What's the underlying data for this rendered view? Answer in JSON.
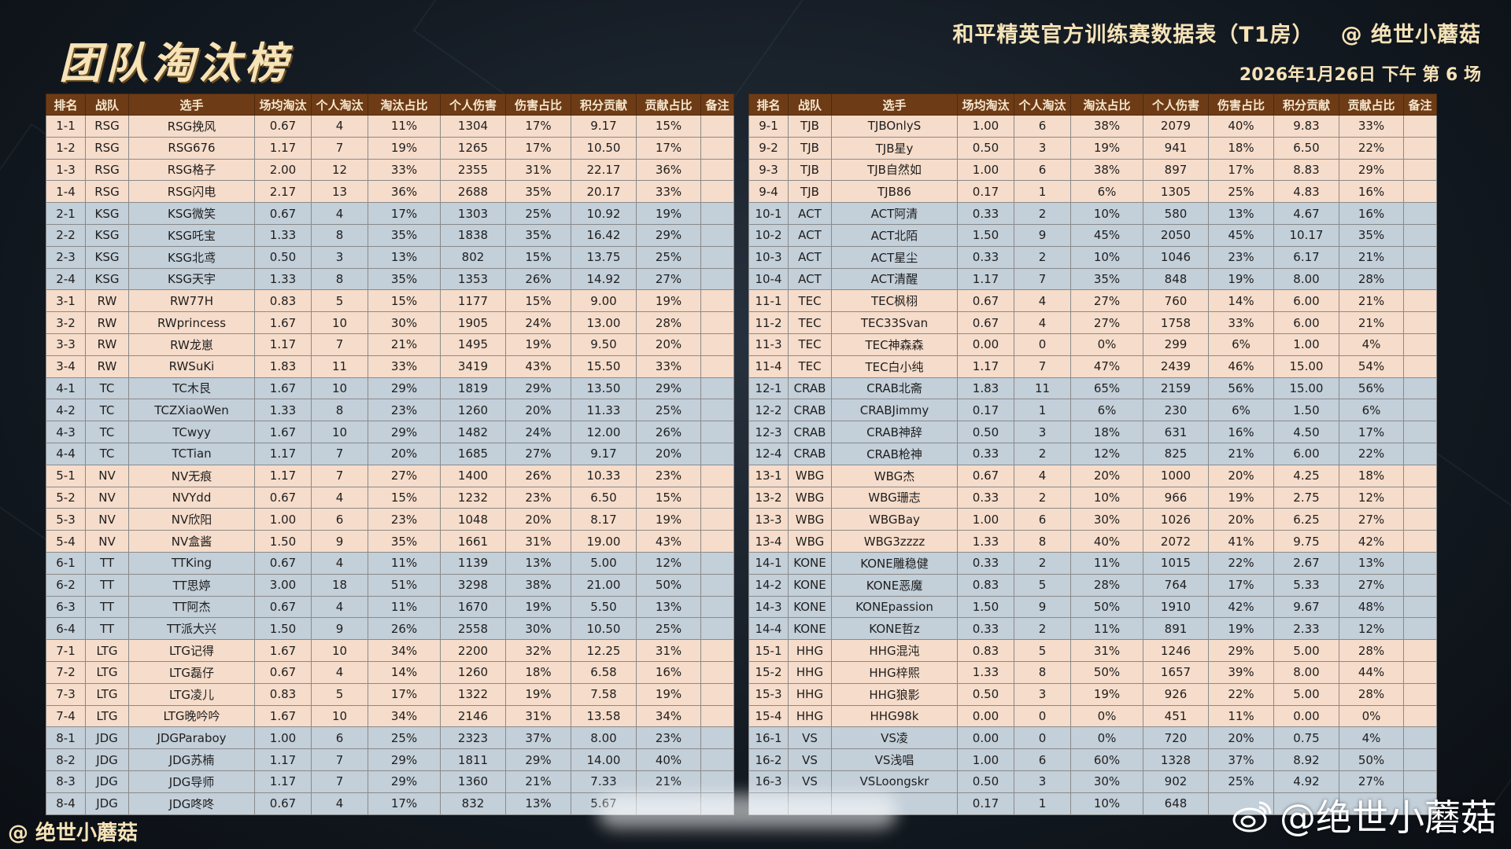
{
  "title": "团队淘汰榜",
  "sheet_title": "和平精英官方训练赛数据表（T1房）",
  "author": "@ 绝世小蘑菇",
  "date": "2026年1月26日 下午 第 6 场",
  "footer_logo": "@ 绝世小蘑菇",
  "watermark": "@绝世小蘑菇",
  "colors": {
    "header_bg": "#6d3c16",
    "header_text": "#f7e7cf",
    "row_peach": "#f6dcca",
    "row_blue": "#c3cfd9",
    "title_gold": "#f6e3b8"
  },
  "columns": [
    "排名",
    "战队",
    "选手",
    "场均淘汰",
    "个人淘汰",
    "淘汰占比",
    "个人伤害",
    "伤害占比",
    "积分贡献",
    "贡献占比",
    "备注"
  ],
  "left_rows": [
    [
      "1-1",
      "RSG",
      "RSG挽风",
      "0.67",
      "4",
      "11%",
      "1304",
      "17%",
      "9.17",
      "15%",
      ""
    ],
    [
      "1-2",
      "RSG",
      "RSG676",
      "1.17",
      "7",
      "19%",
      "1265",
      "17%",
      "10.50",
      "17%",
      ""
    ],
    [
      "1-3",
      "RSG",
      "RSG格子",
      "2.00",
      "12",
      "33%",
      "2355",
      "31%",
      "22.17",
      "36%",
      ""
    ],
    [
      "1-4",
      "RSG",
      "RSG闪电",
      "2.17",
      "13",
      "36%",
      "2688",
      "35%",
      "20.17",
      "33%",
      ""
    ],
    [
      "2-1",
      "KSG",
      "KSG微笑",
      "0.67",
      "4",
      "17%",
      "1303",
      "25%",
      "10.92",
      "19%",
      ""
    ],
    [
      "2-2",
      "KSG",
      "KSG吒宝",
      "1.33",
      "8",
      "35%",
      "1838",
      "35%",
      "16.42",
      "29%",
      ""
    ],
    [
      "2-3",
      "KSG",
      "KSG北鸢",
      "0.50",
      "3",
      "13%",
      "802",
      "15%",
      "13.75",
      "25%",
      ""
    ],
    [
      "2-4",
      "KSG",
      "KSG天宇",
      "1.33",
      "8",
      "35%",
      "1353",
      "26%",
      "14.92",
      "27%",
      ""
    ],
    [
      "3-1",
      "RW",
      "RW77H",
      "0.83",
      "5",
      "15%",
      "1177",
      "15%",
      "9.00",
      "19%",
      ""
    ],
    [
      "3-2",
      "RW",
      "RWprincess",
      "1.67",
      "10",
      "30%",
      "1905",
      "24%",
      "13.00",
      "28%",
      ""
    ],
    [
      "3-3",
      "RW",
      "RW龙崽",
      "1.17",
      "7",
      "21%",
      "1495",
      "19%",
      "9.50",
      "20%",
      ""
    ],
    [
      "3-4",
      "RW",
      "RWSuKi",
      "1.83",
      "11",
      "33%",
      "3419",
      "43%",
      "15.50",
      "33%",
      ""
    ],
    [
      "4-1",
      "TC",
      "TC木艮",
      "1.67",
      "10",
      "29%",
      "1819",
      "29%",
      "13.50",
      "29%",
      ""
    ],
    [
      "4-2",
      "TC",
      "TCZXiaoWen",
      "1.33",
      "8",
      "23%",
      "1260",
      "20%",
      "11.33",
      "25%",
      ""
    ],
    [
      "4-3",
      "TC",
      "TCwyy",
      "1.67",
      "10",
      "29%",
      "1482",
      "24%",
      "12.00",
      "26%",
      ""
    ],
    [
      "4-4",
      "TC",
      "TCTian",
      "1.17",
      "7",
      "20%",
      "1685",
      "27%",
      "9.17",
      "20%",
      ""
    ],
    [
      "5-1",
      "NV",
      "NV无痕",
      "1.17",
      "7",
      "27%",
      "1400",
      "26%",
      "10.33",
      "23%",
      ""
    ],
    [
      "5-2",
      "NV",
      "NVYdd",
      "0.67",
      "4",
      "15%",
      "1232",
      "23%",
      "6.50",
      "15%",
      ""
    ],
    [
      "5-3",
      "NV",
      "NV欣阳",
      "1.00",
      "6",
      "23%",
      "1048",
      "20%",
      "8.17",
      "19%",
      ""
    ],
    [
      "5-4",
      "NV",
      "NV盒酱",
      "1.50",
      "9",
      "35%",
      "1661",
      "31%",
      "19.00",
      "43%",
      ""
    ],
    [
      "6-1",
      "TT",
      "TTKing",
      "0.67",
      "4",
      "11%",
      "1139",
      "13%",
      "5.00",
      "12%",
      ""
    ],
    [
      "6-2",
      "TT",
      "TT思婷",
      "3.00",
      "18",
      "51%",
      "3298",
      "38%",
      "21.00",
      "50%",
      ""
    ],
    [
      "6-3",
      "TT",
      "TT阿杰",
      "0.67",
      "4",
      "11%",
      "1670",
      "19%",
      "5.50",
      "13%",
      ""
    ],
    [
      "6-4",
      "TT",
      "TT派大兴",
      "1.50",
      "9",
      "26%",
      "2558",
      "30%",
      "10.50",
      "25%",
      ""
    ],
    [
      "7-1",
      "LTG",
      "LTG记得",
      "1.67",
      "10",
      "34%",
      "2200",
      "32%",
      "12.25",
      "31%",
      ""
    ],
    [
      "7-2",
      "LTG",
      "LTG磊仔",
      "0.67",
      "4",
      "14%",
      "1260",
      "18%",
      "6.58",
      "16%",
      ""
    ],
    [
      "7-3",
      "LTG",
      "LTG凌儿",
      "0.83",
      "5",
      "17%",
      "1322",
      "19%",
      "7.58",
      "19%",
      ""
    ],
    [
      "7-4",
      "LTG",
      "LTG晚吟吟",
      "1.67",
      "10",
      "34%",
      "2146",
      "31%",
      "13.58",
      "34%",
      ""
    ],
    [
      "8-1",
      "JDG",
      "JDGParaboy",
      "1.00",
      "6",
      "25%",
      "2323",
      "37%",
      "8.00",
      "23%",
      ""
    ],
    [
      "8-2",
      "JDG",
      "JDG苏楠",
      "1.17",
      "7",
      "29%",
      "1811",
      "29%",
      "14.00",
      "40%",
      ""
    ],
    [
      "8-3",
      "JDG",
      "JDG导师",
      "1.17",
      "7",
      "29%",
      "1360",
      "21%",
      "7.33",
      "21%",
      ""
    ],
    [
      "8-4",
      "JDG",
      "JDG咚咚",
      "0.67",
      "4",
      "17%",
      "832",
      "13%",
      "5.67",
      "",
      ""
    ]
  ],
  "right_rows": [
    [
      "9-1",
      "TJB",
      "TJBOnlyS",
      "1.00",
      "6",
      "38%",
      "2079",
      "40%",
      "9.83",
      "33%",
      ""
    ],
    [
      "9-2",
      "TJB",
      "TJB星y",
      "0.50",
      "3",
      "19%",
      "941",
      "18%",
      "6.50",
      "22%",
      ""
    ],
    [
      "9-3",
      "TJB",
      "TJB自然如",
      "1.00",
      "6",
      "38%",
      "897",
      "17%",
      "8.83",
      "29%",
      ""
    ],
    [
      "9-4",
      "TJB",
      "TJB86",
      "0.17",
      "1",
      "6%",
      "1305",
      "25%",
      "4.83",
      "16%",
      ""
    ],
    [
      "10-1",
      "ACT",
      "ACT阿清",
      "0.33",
      "2",
      "10%",
      "580",
      "13%",
      "4.67",
      "16%",
      ""
    ],
    [
      "10-2",
      "ACT",
      "ACT北陌",
      "1.50",
      "9",
      "45%",
      "2050",
      "45%",
      "10.17",
      "35%",
      ""
    ],
    [
      "10-3",
      "ACT",
      "ACT星尘",
      "0.33",
      "2",
      "10%",
      "1046",
      "23%",
      "6.17",
      "21%",
      ""
    ],
    [
      "10-4",
      "ACT",
      "ACT清醒",
      "1.17",
      "7",
      "35%",
      "848",
      "19%",
      "8.00",
      "28%",
      ""
    ],
    [
      "11-1",
      "TEC",
      "TEC枫栩",
      "0.67",
      "4",
      "27%",
      "760",
      "14%",
      "6.00",
      "21%",
      ""
    ],
    [
      "11-2",
      "TEC",
      "TEC33Svan",
      "0.67",
      "4",
      "27%",
      "1758",
      "33%",
      "6.00",
      "21%",
      ""
    ],
    [
      "11-3",
      "TEC",
      "TEC神森森",
      "0.00",
      "0",
      "0%",
      "299",
      "6%",
      "1.00",
      "4%",
      ""
    ],
    [
      "11-4",
      "TEC",
      "TEC白小纯",
      "1.17",
      "7",
      "47%",
      "2439",
      "46%",
      "15.00",
      "54%",
      ""
    ],
    [
      "12-1",
      "CRAB",
      "CRAB北斋",
      "1.83",
      "11",
      "65%",
      "2159",
      "56%",
      "15.00",
      "56%",
      ""
    ],
    [
      "12-2",
      "CRAB",
      "CRABJimmy",
      "0.17",
      "1",
      "6%",
      "230",
      "6%",
      "1.50",
      "6%",
      ""
    ],
    [
      "12-3",
      "CRAB",
      "CRAB神辞",
      "0.50",
      "3",
      "18%",
      "631",
      "16%",
      "4.50",
      "17%",
      ""
    ],
    [
      "12-4",
      "CRAB",
      "CRAB枪神",
      "0.33",
      "2",
      "12%",
      "825",
      "21%",
      "6.00",
      "22%",
      ""
    ],
    [
      "13-1",
      "WBG",
      "WBG杰",
      "0.67",
      "4",
      "20%",
      "1000",
      "20%",
      "4.25",
      "18%",
      ""
    ],
    [
      "13-2",
      "WBG",
      "WBG珊志",
      "0.33",
      "2",
      "10%",
      "966",
      "19%",
      "2.75",
      "12%",
      ""
    ],
    [
      "13-3",
      "WBG",
      "WBGBay",
      "1.00",
      "6",
      "30%",
      "1026",
      "20%",
      "6.25",
      "27%",
      ""
    ],
    [
      "13-4",
      "WBG",
      "WBG3zzzz",
      "1.33",
      "8",
      "40%",
      "2072",
      "41%",
      "9.75",
      "42%",
      ""
    ],
    [
      "14-1",
      "KONE",
      "KONE雕稳健",
      "0.33",
      "2",
      "11%",
      "1015",
      "22%",
      "2.67",
      "13%",
      ""
    ],
    [
      "14-2",
      "KONE",
      "KONE恶魔",
      "0.83",
      "5",
      "28%",
      "764",
      "17%",
      "5.33",
      "27%",
      ""
    ],
    [
      "14-3",
      "KONE",
      "KONEpassion",
      "1.50",
      "9",
      "50%",
      "1910",
      "42%",
      "9.67",
      "48%",
      ""
    ],
    [
      "14-4",
      "KONE",
      "KONE哲z",
      "0.33",
      "2",
      "11%",
      "891",
      "19%",
      "2.33",
      "12%",
      ""
    ],
    [
      "15-1",
      "HHG",
      "HHG混沌",
      "0.83",
      "5",
      "31%",
      "1246",
      "29%",
      "5.00",
      "28%",
      ""
    ],
    [
      "15-2",
      "HHG",
      "HHG梓熙",
      "1.33",
      "8",
      "50%",
      "1657",
      "39%",
      "8.00",
      "44%",
      ""
    ],
    [
      "15-3",
      "HHG",
      "HHG狼影",
      "0.50",
      "3",
      "19%",
      "926",
      "22%",
      "5.00",
      "28%",
      ""
    ],
    [
      "15-4",
      "HHG",
      "HHG98k",
      "0.00",
      "0",
      "0%",
      "451",
      "11%",
      "0.00",
      "0%",
      ""
    ],
    [
      "16-1",
      "VS",
      "VS凌",
      "0.00",
      "0",
      "0%",
      "720",
      "20%",
      "0.75",
      "4%",
      ""
    ],
    [
      "16-2",
      "VS",
      "VS浅唱",
      "1.00",
      "6",
      "60%",
      "1328",
      "37%",
      "8.92",
      "50%",
      ""
    ],
    [
      "16-3",
      "VS",
      "VSLoongskr",
      "0.50",
      "3",
      "30%",
      "902",
      "25%",
      "4.92",
      "27%",
      ""
    ],
    [
      "",
      "",
      "",
      "0.17",
      "1",
      "10%",
      "648",
      "",
      "",
      "",
      ""
    ]
  ]
}
